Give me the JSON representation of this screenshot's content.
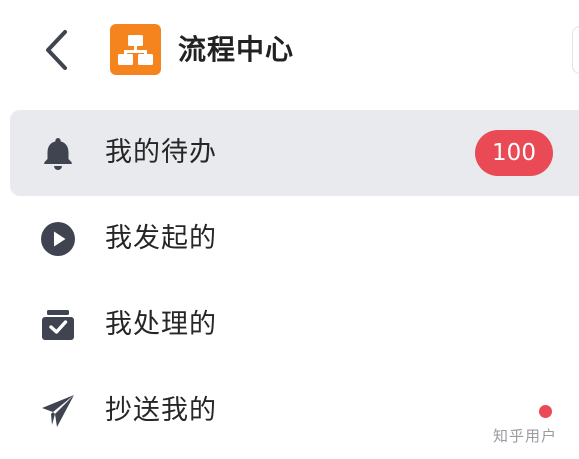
{
  "header": {
    "back_icon": "chevron-left-icon",
    "logo_icon": "org-chart-icon",
    "title": "流程中心"
  },
  "menu": {
    "items": [
      {
        "label": "我的待办",
        "icon": "bell-icon",
        "active": true,
        "badge": "100"
      },
      {
        "label": "我发起的",
        "icon": "play-circle-icon",
        "active": false
      },
      {
        "label": "我处理的",
        "icon": "archive-check-icon",
        "active": false
      },
      {
        "label": "抄送我的",
        "icon": "paper-plane-icon",
        "active": false,
        "dot": true
      }
    ]
  },
  "colors": {
    "accent": "#f5831e",
    "badge": "#ea4a55",
    "active_bg": "#e9eaee",
    "icon": "#3f4450"
  },
  "watermark": "知乎用户"
}
